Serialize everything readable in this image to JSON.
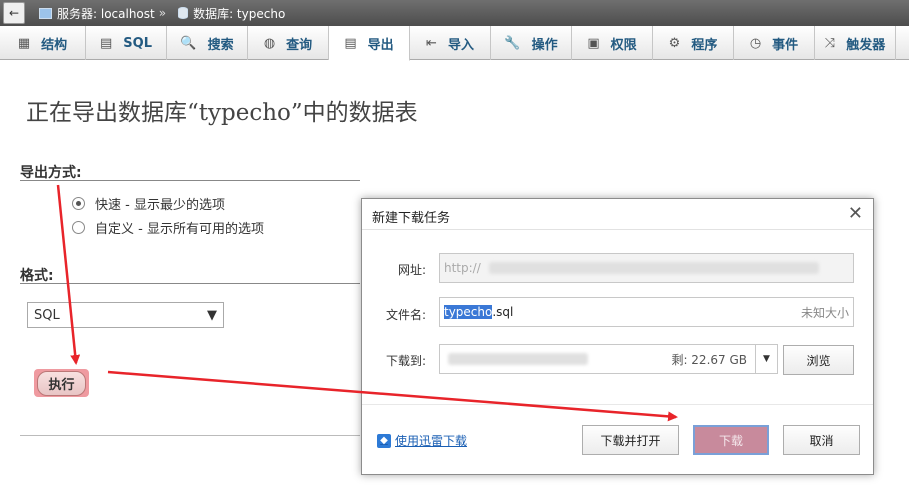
{
  "breadcrumb": {
    "back_glyph": "←",
    "server_label": "服务器: localhost",
    "separator": "»",
    "db_label": "数据库: typecho"
  },
  "tabs": [
    {
      "label": "结构",
      "icon": "structure-icon",
      "glyph": "▦"
    },
    {
      "label": "SQL",
      "icon": "sql-icon",
      "glyph": "▤"
    },
    {
      "label": "搜索",
      "icon": "search-icon",
      "glyph": "🔍"
    },
    {
      "label": "查询",
      "icon": "query-icon",
      "glyph": "◍"
    },
    {
      "label": "导出",
      "icon": "export-icon",
      "glyph": "▤",
      "active": true
    },
    {
      "label": "导入",
      "icon": "import-icon",
      "glyph": "⇤"
    },
    {
      "label": "操作",
      "icon": "wrench-icon",
      "glyph": "🔧"
    },
    {
      "label": "权限",
      "icon": "privileges-icon",
      "glyph": "▣"
    },
    {
      "label": "程序",
      "icon": "routines-icon",
      "glyph": "⚙"
    },
    {
      "label": "事件",
      "icon": "clock-icon",
      "glyph": "◷"
    },
    {
      "label": "触发器",
      "icon": "triggers-icon",
      "glyph": "⤨"
    }
  ],
  "main": {
    "title": "正在导出数据库“typecho”中的数据表",
    "export_method_label": "导出方式:",
    "options": [
      {
        "label": "快速 - 显示最少的选项",
        "checked": true
      },
      {
        "label": "自定义 - 显示所有可用的选项",
        "checked": false
      }
    ],
    "format_label": "格式:",
    "format_value": "SQL",
    "go_button": "执行"
  },
  "dialog": {
    "title": "新建下载任务",
    "close_glyph": "✕",
    "url_label": "网址:",
    "url_value": "http://",
    "filename_label": "文件名:",
    "filename_selected": "typecho",
    "filename_rest": ".sql",
    "size_hint": "未知大小",
    "download_to_label": "下载到:",
    "free_space": "剩: 22.67 GB",
    "browse_button": "浏览",
    "xunlei_link": "使用迅雷下载",
    "download_open_button": "下载并打开",
    "download_button": "下载",
    "cancel_button": "取消"
  },
  "colors": {
    "tab_text": "#235a81",
    "arrow": "#e8242a",
    "primary_button": "#c88a9c",
    "selection": "#3a78d6"
  }
}
